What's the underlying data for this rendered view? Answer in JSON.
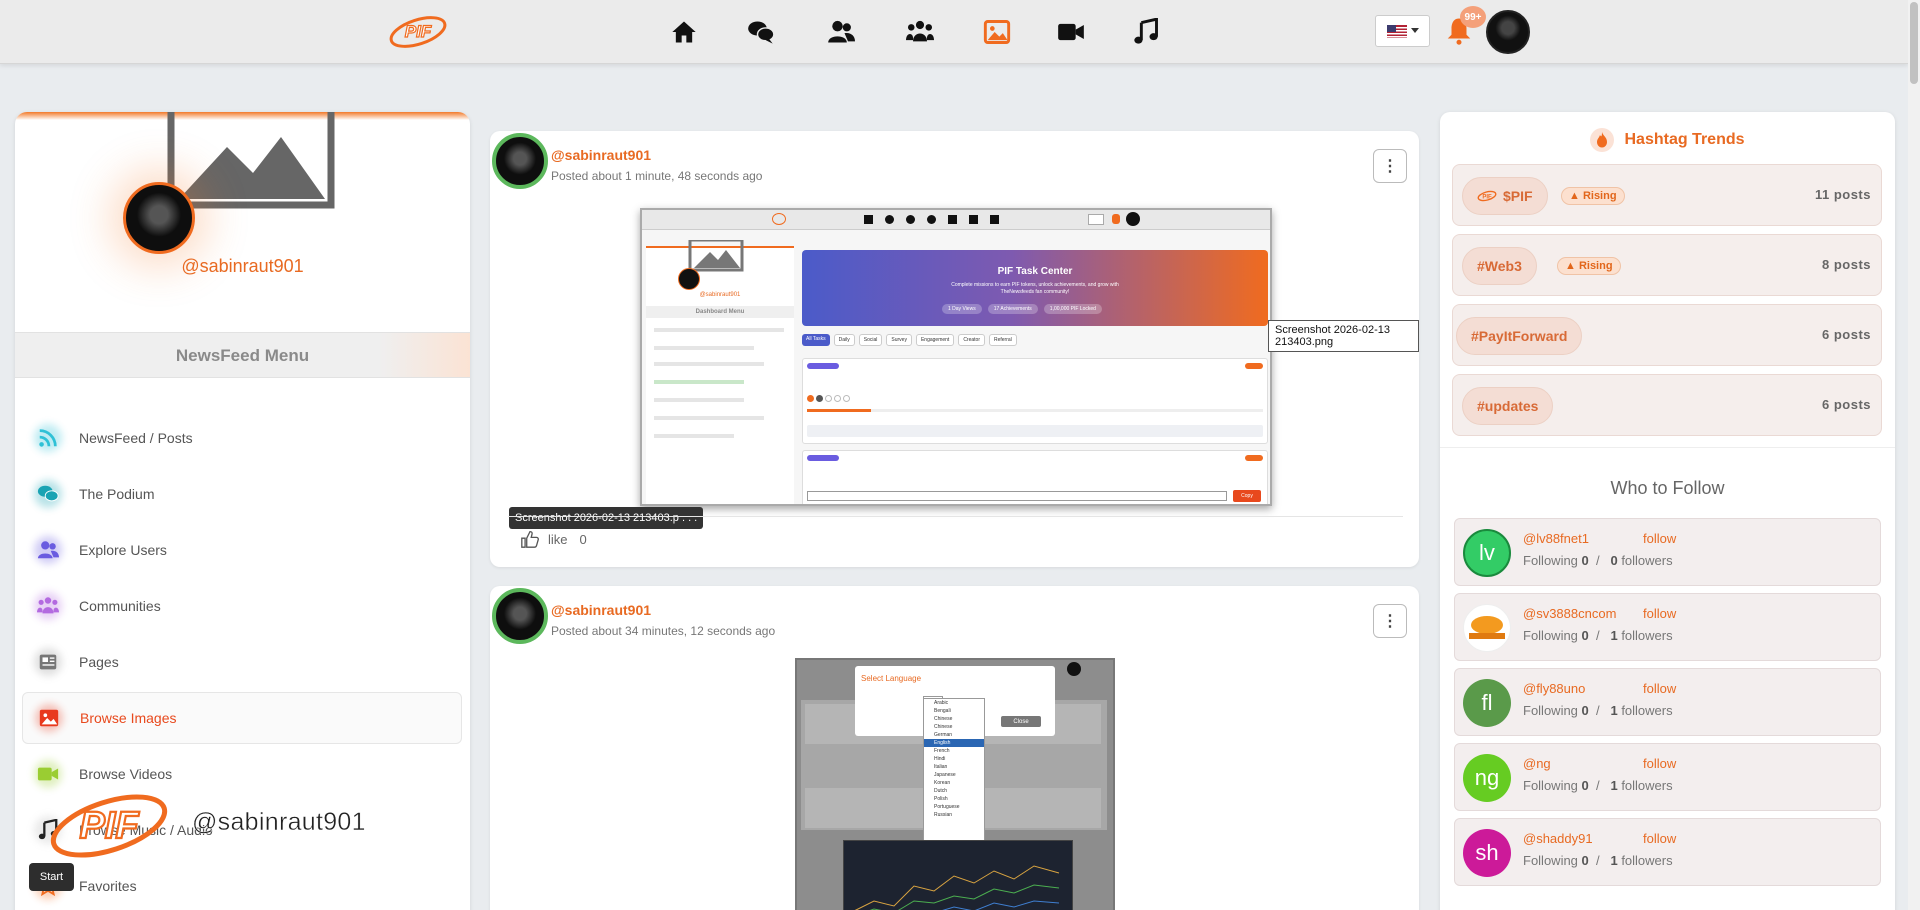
{
  "topbar": {
    "logo_text": "PIF",
    "nav_icons": [
      "home-icon",
      "chat-icon",
      "users-icon",
      "communities-icon",
      "image-icon",
      "video-icon",
      "music-icon"
    ],
    "active_nav": "image-icon",
    "notification_count": "99+",
    "accent": "#f06b1f"
  },
  "profile": {
    "username": "@sabinraut901"
  },
  "menu": {
    "title": "NewsFeed Menu",
    "items": [
      {
        "label": "NewsFeed / Posts",
        "icon": "rss-icon",
        "color": "#2fc1d6"
      },
      {
        "label": "The Podium",
        "icon": "chat-icon",
        "color": "#1aa3b3"
      },
      {
        "label": "Explore Users",
        "icon": "users-icon",
        "color": "#6a5ce0"
      },
      {
        "label": "Communities",
        "icon": "communities-icon",
        "color": "#b36ae0"
      },
      {
        "label": "Pages",
        "icon": "newspaper-icon",
        "color": "#777777"
      },
      {
        "label": "Browse Images",
        "icon": "image-icon",
        "color": "#e8391d"
      },
      {
        "label": "Browse Videos",
        "icon": "video-icon",
        "color": "#9acd32"
      },
      {
        "label": "Browse Music / Audio",
        "icon": "music-icon",
        "color": "#222222"
      },
      {
        "label": "Favorites",
        "icon": "star-icon",
        "color": "#f06b1f"
      }
    ]
  },
  "overlay": {
    "logo_text": "PIF",
    "username": "@sabinraut901"
  },
  "posts": [
    {
      "user": "@sabinraut901",
      "time": "Posted about 1 minute, 48 seconds ago",
      "menu": "⋮",
      "image_caption": "Screenshot 2026-02-13 213403.p . . .",
      "image_tooltip": "Screenshot 2026-02-13 213403.png",
      "like_label": "like",
      "like_count": "0",
      "inner": {
        "menu_title": "Dashboard Menu",
        "user": "@sabinraut901",
        "banner_title": "PIF Task Center",
        "banner_sub": "Complete missions to earn PIF tokens, unlock achievements, and grow with TheNewsfeeds fan community!",
        "pills": [
          "1 Day Views",
          "17 Achievements",
          "1,00,000 PIF Locked"
        ],
        "tabs": [
          "All Tasks",
          "Daily",
          "Social",
          "Survey",
          "Engagement",
          "Creator",
          "Referral"
        ],
        "copy_label": "Copy"
      }
    },
    {
      "user": "@sabinraut901",
      "time": "Posted about 34 minutes, 12 seconds ago",
      "menu": "⋮",
      "inner": {
        "modal_title": "Select Language",
        "close_label": "Close",
        "languages": [
          "Arabic",
          "Bengali",
          "Chinese",
          "Chinese",
          "German",
          "English",
          "French",
          "Hindi",
          "Italian",
          "Japanese",
          "Korean",
          "Dutch",
          "Polish",
          "Portuguese",
          "Russian"
        ]
      }
    }
  ],
  "start_button": "Start",
  "hashtags": {
    "title": "Hashtag Trends",
    "items": [
      {
        "tag": "$PIF",
        "rising": "▲ Rising",
        "count": "11 posts"
      },
      {
        "tag": "#Web3",
        "rising": "▲ Rising",
        "count": "8 posts"
      },
      {
        "tag": "#PayItForward",
        "rising": "",
        "count": "6 posts"
      },
      {
        "tag": "#updates",
        "rising": "",
        "count": "6 posts"
      }
    ]
  },
  "who_to_follow": {
    "title": "Who to Follow",
    "follow_label": "follow",
    "following_label": "Following",
    "followers_label": "followers",
    "users": [
      {
        "name": "@lv88fnet1",
        "initials": "lv",
        "color": "#33cc66",
        "following": "0",
        "followers": "0"
      },
      {
        "name": "@sv3888cncom",
        "initials": "",
        "color": "#ffffff",
        "following": "0",
        "followers": "1"
      },
      {
        "name": "@fly88uno",
        "initials": "fl",
        "color": "#5a9a4a",
        "following": "0",
        "followers": "1"
      },
      {
        "name": "@ng",
        "initials": "ng",
        "color": "#66cc22",
        "following": "0",
        "followers": "1"
      },
      {
        "name": "@shaddy91",
        "initials": "sh",
        "color": "#cc1a99",
        "following": "0",
        "followers": "1"
      }
    ]
  }
}
